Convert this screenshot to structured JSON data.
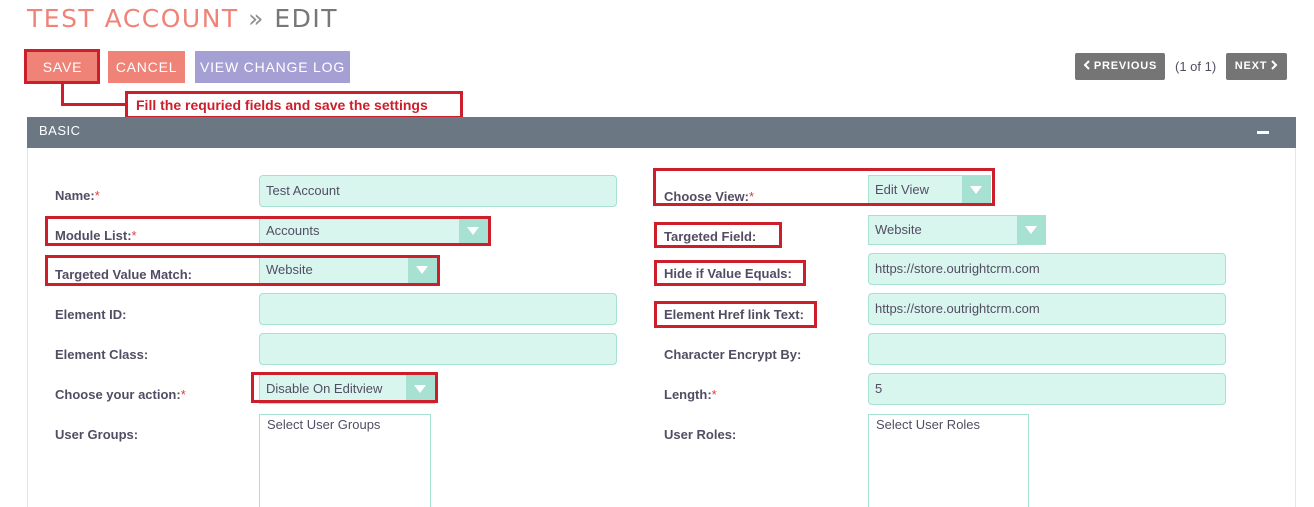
{
  "header": {
    "title_module": "TEST ACCOUNT",
    "title_separator": "»",
    "title_action": "EDIT"
  },
  "toolbar": {
    "save_label": "SAVE",
    "cancel_label": "CANCEL",
    "change_log_label": "VIEW CHANGE LOG"
  },
  "pagination": {
    "previous_label": "PREVIOUS",
    "count_label": "(1 of 1)",
    "next_label": "NEXT"
  },
  "callout": {
    "text": "Fill the requried fields and save the settings"
  },
  "panel": {
    "title": "BASIC"
  },
  "required_marker": "*",
  "left_fields": {
    "name": {
      "label": "Name:",
      "value": "Test Account"
    },
    "module_list": {
      "label": "Module List:",
      "value": "Accounts"
    },
    "targeted_value_match": {
      "label": "Targeted Value Match:",
      "value": "Website"
    },
    "element_id": {
      "label": "Element ID:",
      "value": ""
    },
    "element_class": {
      "label": "Element Class:",
      "value": ""
    },
    "choose_action": {
      "label": "Choose your action:",
      "value": "Disable On Editview"
    },
    "user_groups": {
      "label": "User Groups:",
      "value": "Select User Groups"
    }
  },
  "right_fields": {
    "choose_view": {
      "label": "Choose View:",
      "value": "Edit View"
    },
    "targeted_field": {
      "label": "Targeted Field:",
      "value": "Website"
    },
    "hide_if_value_equals": {
      "label": "Hide if Value Equals:",
      "value": "https://store.outrightcrm.com"
    },
    "element_href_link_text": {
      "label": "Element Href link Text:",
      "value": "https://store.outrightcrm.com"
    },
    "character_encrypt_by": {
      "label": "Character Encrypt By:",
      "value": ""
    },
    "length": {
      "label": "Length:",
      "value": "5"
    },
    "user_roles": {
      "label": "User Roles:",
      "value": "Select User Roles"
    }
  },
  "colors": {
    "accent_salmon": "#f08377",
    "accent_purple": "#a5a0d4",
    "panel_header": "#6b7782",
    "field_bg": "#d8f5ee",
    "field_border": "#a6e1d2",
    "annotation_red": "#cc1f2b",
    "nav_gray": "#757575"
  },
  "icons": {
    "previous": "chevron-left-icon",
    "next": "chevron-right-icon",
    "collapse": "minus-icon",
    "dropdown": "dropdown-arrow-icon"
  }
}
